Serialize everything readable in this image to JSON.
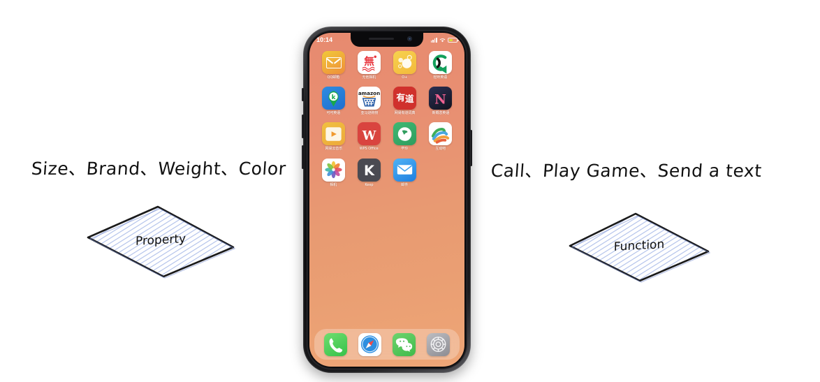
{
  "diagram": {
    "left_annotation": "Size、Brand、Weight、Color",
    "right_annotation": "Call、Play Game、Send a text",
    "left_diamond_label": "Property",
    "right_diamond_label": "Function",
    "hatch_color": "#8fa6e0",
    "outline_color": "#1a1a1a",
    "text_color": "#111111"
  },
  "phone": {
    "status_bar": {
      "time": "10:14",
      "signal_icon": "cellular-signal-icon",
      "wifi_icon": "wifi-icon",
      "battery_icon": "battery-icon",
      "battery_level_percent": 45
    },
    "wallpaper_colors": {
      "top": "#e78a6f",
      "bottom": "#eea677"
    },
    "home_screen": {
      "rows": [
        [
          {
            "label": "QQ邮箱",
            "icon": "qq-mail-icon"
          },
          {
            "label": "无他相机",
            "icon": "wuta-camera-icon"
          },
          {
            "label": "O+",
            "icon": "o-plus-icon"
          },
          {
            "label": "轻听英语",
            "icon": "qingting-english-icon"
          }
        ],
        [
          {
            "label": "可可英语",
            "icon": "kekenet-english-icon"
          },
          {
            "label": "亚马逊购物",
            "icon": "amazon-icon"
          },
          {
            "label": "网易有道词典",
            "icon": "youdao-dictionary-icon"
          },
          {
            "label": "新概念英语",
            "icon": "netflix-style-n-icon"
          }
        ],
        [
          {
            "label": "网易云音乐",
            "icon": "music-play-icon"
          },
          {
            "label": "WPS Office",
            "icon": "wps-office-icon"
          },
          {
            "label": "毕玲",
            "icon": "biling-icon"
          },
          {
            "label": "互动吧",
            "icon": "hudongba-icon"
          }
        ],
        [
          {
            "label": "相机",
            "icon": "photos-icon"
          },
          {
            "label": "Keep",
            "icon": "keep-icon"
          },
          {
            "label": "邮件",
            "icon": "mail-icon"
          }
        ]
      ],
      "dock": [
        {
          "label": "电话",
          "icon": "phone-icon"
        },
        {
          "label": "Safari",
          "icon": "safari-icon"
        },
        {
          "label": "微信",
          "icon": "wechat-icon"
        },
        {
          "label": "设置",
          "icon": "settings-icon"
        }
      ]
    },
    "hardware_buttons": [
      {
        "name": "silent-switch"
      },
      {
        "name": "volume-up-button"
      },
      {
        "name": "volume-down-button"
      },
      {
        "name": "power-button"
      }
    ]
  }
}
